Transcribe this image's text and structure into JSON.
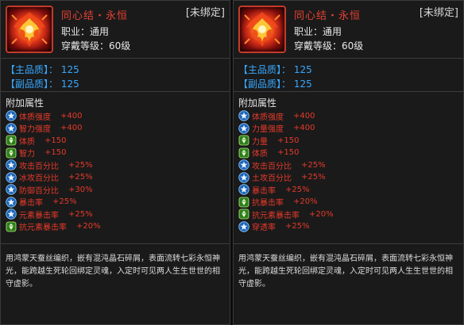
{
  "panels": [
    {
      "item_name": "同心结・永恒",
      "bind_status": "[未绑定]",
      "profession": "职业：通用",
      "level_req": "穿戴等级：60级",
      "main_quality": "【主品质】：  125",
      "sub_quality": "【副品质】：  125",
      "attr_title": "附加属性",
      "attributes": [
        {
          "icon": "blue-star-icon",
          "name": "体质强度",
          "value": "+400"
        },
        {
          "icon": "blue-star-icon",
          "name": "智力强度",
          "value": "+400"
        },
        {
          "icon": "green-gem-icon",
          "name": "体质",
          "value": "+150"
        },
        {
          "icon": "green-gem-icon",
          "name": "智力",
          "value": "+150"
        },
        {
          "icon": "blue-star-icon",
          "name": "攻击百分比",
          "value": "+25%"
        },
        {
          "icon": "blue-star-icon",
          "name": "冰攻百分比",
          "value": "+25%"
        },
        {
          "icon": "blue-star-icon",
          "name": "防御百分比",
          "value": "+30%"
        },
        {
          "icon": "blue-star-icon",
          "name": "暴击率",
          "value": "+25%"
        },
        {
          "icon": "blue-star-icon",
          "name": "元素暴击率",
          "value": "+25%"
        },
        {
          "icon": "green-gem-icon",
          "name": "抗元素暴击率",
          "value": "+20%"
        }
      ],
      "description": "用鸿蒙天蚕丝编织，嵌有混沌晶石碎屑，表面流转七彩永恒神光，能跨越生死轮回绑定灵魂，入定时可见两人生生世世的相守虚影。"
    },
    {
      "item_name": "同心结・永恒",
      "bind_status": "[未绑定]",
      "profession": "职业：通用",
      "level_req": "穿戴等级：60级",
      "main_quality": "【主品质】：  125",
      "sub_quality": "【副品质】：  125",
      "attr_title": "附加属性",
      "attributes": [
        {
          "icon": "blue-star-icon",
          "name": "体质强度",
          "value": "+400"
        },
        {
          "icon": "blue-star-icon",
          "name": "力量强度",
          "value": "+400"
        },
        {
          "icon": "green-gem-icon",
          "name": "力量",
          "value": "+150"
        },
        {
          "icon": "green-gem-icon",
          "name": "体质",
          "value": "+150"
        },
        {
          "icon": "blue-star-icon",
          "name": "攻击百分比",
          "value": "+25%"
        },
        {
          "icon": "blue-star-icon",
          "name": "土攻百分比",
          "value": "+25%"
        },
        {
          "icon": "blue-star-icon",
          "name": "暴击率",
          "value": "+25%"
        },
        {
          "icon": "green-gem-icon",
          "name": "抗暴击率",
          "value": "+20%"
        },
        {
          "icon": "green-gem-icon",
          "name": "抗元素暴击率",
          "value": "+20%"
        },
        {
          "icon": "blue-star-icon",
          "name": "穿透率",
          "value": "+25%"
        }
      ],
      "description": "用鸿蒙天蚕丝编织，嵌有混沌晶石碎屑，表面流转七彩永恒神光，能跨越生死轮回绑定灵魂，入定时可见两人生生世世的相守虚影。"
    }
  ],
  "colors": {
    "item_name": "#e64033",
    "quality": "#37a8ff",
    "attribute": "#e53a2a",
    "text": "#e8e8e8",
    "panel_bg": "#1a1a1a"
  }
}
